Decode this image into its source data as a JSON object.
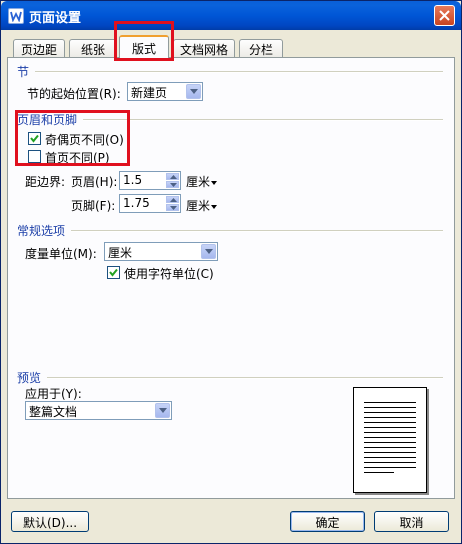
{
  "window": {
    "title": "页面设置",
    "icons": {
      "app": "wps-writer-icon",
      "close": "close-icon"
    }
  },
  "tabs": [
    {
      "label": "页边距",
      "active": false
    },
    {
      "label": "纸张",
      "active": false
    },
    {
      "label": "版式",
      "active": true
    },
    {
      "label": "文档网格",
      "active": false
    },
    {
      "label": "分栏",
      "active": false
    }
  ],
  "section": {
    "header": "节",
    "start_label": "节的起始位置(R):",
    "start_value": "新建页"
  },
  "header_footer": {
    "header": "页眉和页脚",
    "odd_even_label": "奇偶页不同(O)",
    "odd_even_checked": true,
    "first_page_label": "首页不同(P)",
    "first_page_checked": false,
    "distance_label": "距边界:",
    "header_label": "页眉(H):",
    "header_value": "1.5",
    "header_unit": "厘米",
    "footer_label": "页脚(F):",
    "footer_value": "1.75",
    "footer_unit": "厘米"
  },
  "general": {
    "header": "常规选项",
    "unit_label": "度量单位(M):",
    "unit_value": "厘米",
    "char_unit_label": "使用字符单位(C)",
    "char_unit_checked": true
  },
  "preview": {
    "header": "预览",
    "apply_label": "应用于(Y):",
    "apply_value": "整篇文档"
  },
  "buttons": {
    "default": "默认(D)...",
    "ok": "确定",
    "cancel": "取消"
  },
  "colors": {
    "titlebar": "#0054e3",
    "section_header": "#1c3fa8",
    "highlight": "#e0101e"
  }
}
